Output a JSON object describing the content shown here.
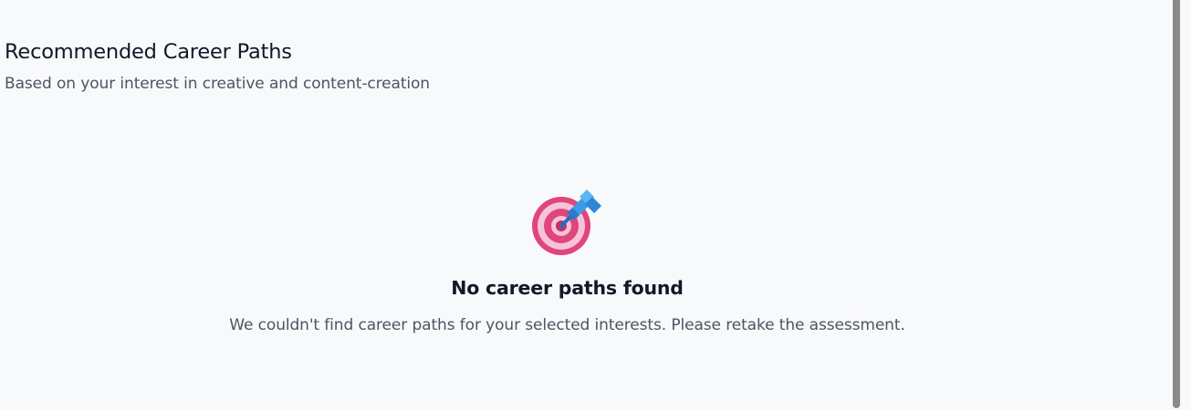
{
  "header": {
    "title": "Recommended Career Paths",
    "subtitle": "Based on your interest in creative and content-creation"
  },
  "empty_state": {
    "icon": "target-dart-icon",
    "title": "No career paths found",
    "message": "We couldn't find career paths for your selected interests. Please retake the assessment."
  },
  "colors": {
    "background": "#f8f9fb",
    "heading": "#111827",
    "body_text": "#4b5563",
    "target_red": "#e0457b",
    "target_pink": "#f6c4d8",
    "dart_blue": "#3b9be8"
  }
}
